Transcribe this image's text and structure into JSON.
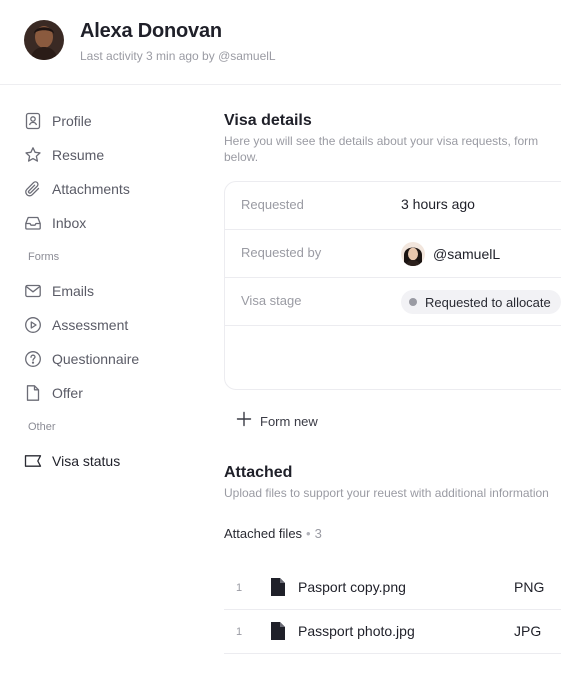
{
  "header": {
    "name": "Alexa Donovan",
    "activity": "Last activity 3 min ago by @samuelL"
  },
  "sidebar": {
    "items": [
      {
        "label": "Profile",
        "icon": "profile-icon"
      },
      {
        "label": "Resume",
        "icon": "star-icon"
      },
      {
        "label": "Attachments",
        "icon": "paperclip-icon"
      },
      {
        "label": "Inbox",
        "icon": "inbox-icon"
      }
    ],
    "forms_label": "Forms",
    "form_items": [
      {
        "label": "Emails",
        "icon": "mail-icon"
      },
      {
        "label": "Assessment",
        "icon": "play-circle-icon"
      },
      {
        "label": "Questionnaire",
        "icon": "help-circle-icon"
      },
      {
        "label": "Offer",
        "icon": "document-icon"
      }
    ],
    "other_label": "Other",
    "other_items": [
      {
        "label": "Visa status",
        "icon": "tag-icon",
        "active": true
      }
    ]
  },
  "visa": {
    "title": "Visa details",
    "description": "Here you will see the details about your visa requests, form below.",
    "rows": [
      {
        "key": "Requested",
        "value": "3 hours ago"
      },
      {
        "key": "Requested by",
        "value": "@samuelL"
      },
      {
        "key": "Visa stage",
        "value": "Requested to allocate"
      }
    ],
    "form_new": "Form new"
  },
  "attached": {
    "title": "Attached",
    "description": "Upload files to support your reuest with additional information",
    "files_label": "Attached files",
    "files_count": "3",
    "files": [
      {
        "num": "1",
        "name": "Pasport copy.png",
        "type": "PNG"
      },
      {
        "num": "1",
        "name": "Passport photo.jpg",
        "type": "JPG"
      }
    ]
  },
  "colors": {
    "accent_text": "#1f2029",
    "muted": "#9a9ba3",
    "border": "#ececf0",
    "status_dot": "#9a9ba3"
  }
}
